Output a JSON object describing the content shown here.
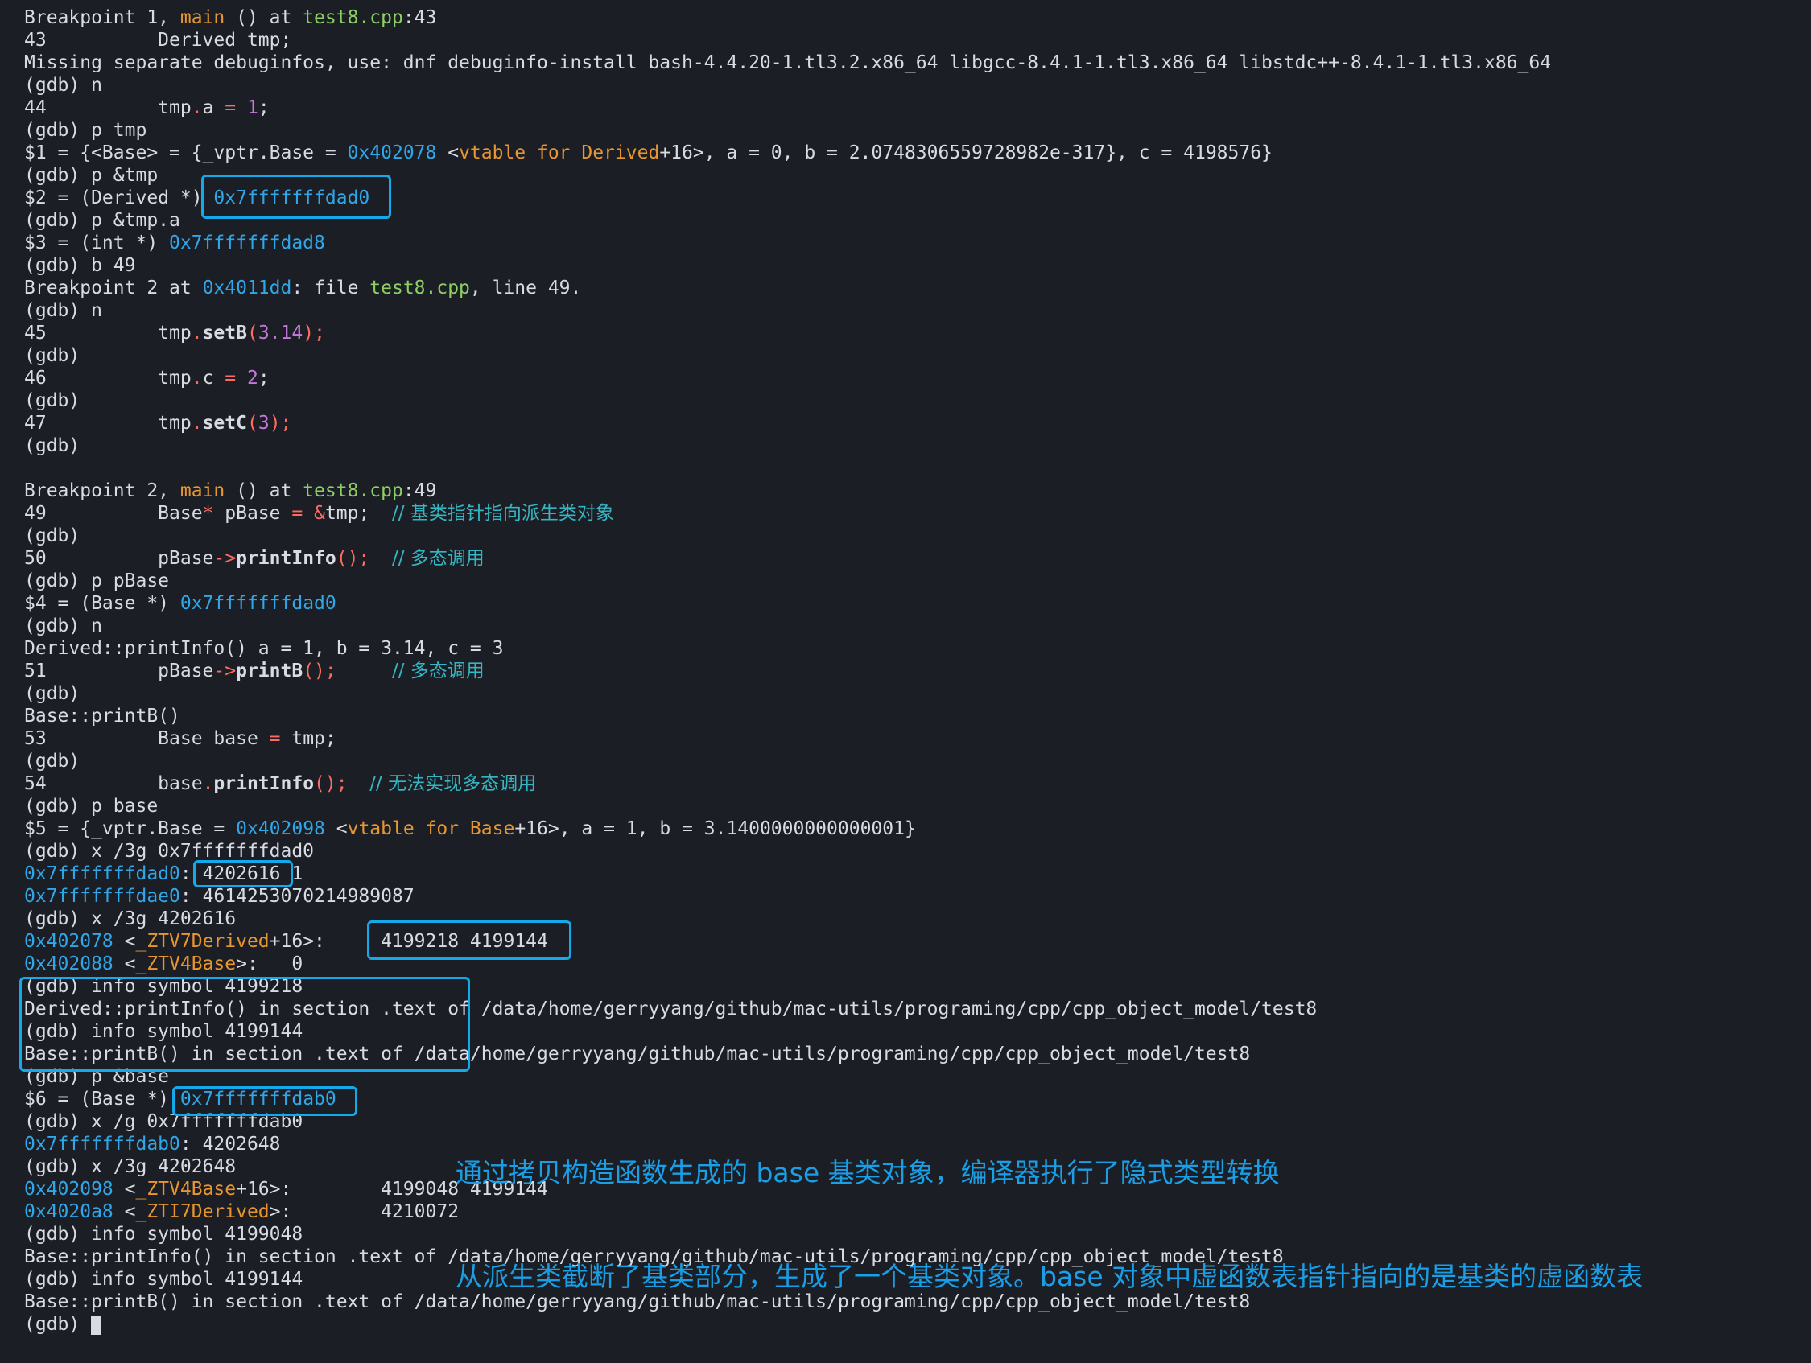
{
  "terminal": {
    "lines": [
      [
        [
          "Breakpoint 1, ",
          "def"
        ],
        [
          "main",
          "sym"
        ],
        [
          " () at ",
          "def"
        ],
        [
          "test8.cpp",
          "file"
        ],
        [
          ":43",
          "def"
        ]
      ],
      [
        [
          "43          Derived tmp;",
          "def"
        ]
      ],
      [
        [
          "Missing separate debuginfos, use: dnf debuginfo-install bash-4.4.20-1.tl3.2.x86_64 libgcc-8.4.1-1.tl3.x86_64 libstdc++-8.4.1-1.tl3.x86_64",
          "def"
        ]
      ],
      [
        [
          "(gdb) n",
          "def"
        ]
      ],
      [
        [
          "44          tmp",
          "def"
        ],
        [
          ".",
          "op"
        ],
        [
          "a ",
          "def"
        ],
        [
          "=",
          "op"
        ],
        [
          " ",
          "def"
        ],
        [
          "1",
          "num"
        ],
        [
          ";",
          "def"
        ]
      ],
      [
        [
          "(gdb) p tmp",
          "def"
        ]
      ],
      [
        [
          "$1 = {<Base> = {_vptr.Base = ",
          "def"
        ],
        [
          "0x402078",
          "addr"
        ],
        [
          " <",
          "def"
        ],
        [
          "vtable for Derived",
          "sym"
        ],
        [
          "+16>, a = 0, b = 2.0748306559728982e-317}, c = 4198576}",
          "def"
        ]
      ],
      [
        [
          "(gdb) p &tmp",
          "def"
        ]
      ],
      [
        [
          "$2 = (Derived *) ",
          "def"
        ],
        [
          "0x7fffffffdad0",
          "addr"
        ]
      ],
      [
        [
          "(gdb) p &tmp.a",
          "def"
        ]
      ],
      [
        [
          "$3 = (int *) ",
          "def"
        ],
        [
          "0x7fffffffdad8",
          "addr"
        ]
      ],
      [
        [
          "(gdb) b 49",
          "def"
        ]
      ],
      [
        [
          "Breakpoint 2 at ",
          "def"
        ],
        [
          "0x4011dd",
          "addr"
        ],
        [
          ": file ",
          "def"
        ],
        [
          "test8.cpp",
          "file"
        ],
        [
          ", line 49.",
          "def"
        ]
      ],
      [
        [
          "(gdb) n",
          "def"
        ]
      ],
      [
        [
          "45          tmp",
          "def"
        ],
        [
          ".",
          "op"
        ],
        [
          "setB",
          "fn"
        ],
        [
          "(",
          "op"
        ],
        [
          "3.14",
          "num"
        ],
        [
          ");",
          "op"
        ]
      ],
      [
        [
          "(gdb)",
          "def"
        ]
      ],
      [
        [
          "46          tmp",
          "def"
        ],
        [
          ".",
          "op"
        ],
        [
          "c ",
          "def"
        ],
        [
          "=",
          "op"
        ],
        [
          " ",
          "def"
        ],
        [
          "2",
          "num"
        ],
        [
          ";",
          "def"
        ]
      ],
      [
        [
          "(gdb)",
          "def"
        ]
      ],
      [
        [
          "47          tmp",
          "def"
        ],
        [
          ".",
          "op"
        ],
        [
          "setC",
          "fn"
        ],
        [
          "(",
          "op"
        ],
        [
          "3",
          "num"
        ],
        [
          ");",
          "op"
        ]
      ],
      [
        [
          "(gdb)",
          "def"
        ]
      ],
      [
        [
          "",
          "def"
        ]
      ],
      [
        [
          "Breakpoint 2, ",
          "def"
        ],
        [
          "main",
          "sym"
        ],
        [
          " () at ",
          "def"
        ],
        [
          "test8.cpp",
          "file"
        ],
        [
          ":49",
          "def"
        ]
      ],
      [
        [
          "49          Base",
          "def"
        ],
        [
          "*",
          "op"
        ],
        [
          " pBase ",
          "def"
        ],
        [
          "=",
          "op"
        ],
        [
          " ",
          "def"
        ],
        [
          "&",
          "op"
        ],
        [
          "tmp;  ",
          "def"
        ],
        [
          "// 基类指针指向派生类对象",
          "cjk"
        ]
      ],
      [
        [
          "(gdb)",
          "def"
        ]
      ],
      [
        [
          "50          pBase",
          "def"
        ],
        [
          "->",
          "op"
        ],
        [
          "printInfo",
          "fn"
        ],
        [
          "();",
          "op"
        ],
        [
          "  ",
          "def"
        ],
        [
          "// 多态调用",
          "cjk"
        ]
      ],
      [
        [
          "(gdb) p pBase",
          "def"
        ]
      ],
      [
        [
          "$4 = (Base *) ",
          "def"
        ],
        [
          "0x7fffffffdad0",
          "addr"
        ]
      ],
      [
        [
          "(gdb) n",
          "def"
        ]
      ],
      [
        [
          "Derived::printInfo() a = 1, b = 3.14, c = 3",
          "def"
        ]
      ],
      [
        [
          "51          pBase",
          "def"
        ],
        [
          "->",
          "op"
        ],
        [
          "printB",
          "fn"
        ],
        [
          "();",
          "op"
        ],
        [
          "     ",
          "def"
        ],
        [
          "// 多态调用",
          "cjk"
        ]
      ],
      [
        [
          "(gdb)",
          "def"
        ]
      ],
      [
        [
          "Base::printB()",
          "def"
        ]
      ],
      [
        [
          "53          Base base ",
          "def"
        ],
        [
          "=",
          "op"
        ],
        [
          " tmp;",
          "def"
        ]
      ],
      [
        [
          "(gdb)",
          "def"
        ]
      ],
      [
        [
          "54          base",
          "def"
        ],
        [
          ".",
          "op"
        ],
        [
          "printInfo",
          "fn"
        ],
        [
          "();",
          "op"
        ],
        [
          "  ",
          "def"
        ],
        [
          "// 无法实现多态调用",
          "cjk"
        ]
      ],
      [
        [
          "(gdb) p base",
          "def"
        ]
      ],
      [
        [
          "$5 = {_vptr.Base = ",
          "def"
        ],
        [
          "0x402098",
          "addr"
        ],
        [
          " <",
          "def"
        ],
        [
          "vtable for Base",
          "sym"
        ],
        [
          "+16>, a = 1, b = 3.1400000000000001}",
          "def"
        ]
      ],
      [
        [
          "(gdb) x /3g 0x7fffffffdad0",
          "def"
        ]
      ],
      [
        [
          "0x7fffffffdad0",
          "addr"
        ],
        [
          ": 4202616 1",
          "def"
        ]
      ],
      [
        [
          "0x7fffffffdae0",
          "addr"
        ],
        [
          ": 4614253070214989087",
          "def"
        ]
      ],
      [
        [
          "(gdb) x /3g 4202616",
          "def"
        ]
      ],
      [
        [
          "0x402078",
          "addr"
        ],
        [
          " <",
          "def"
        ],
        [
          "_ZTV7Derived",
          "sym"
        ],
        [
          "+16>:     4199218 4199144",
          "def"
        ]
      ],
      [
        [
          "0x402088",
          "addr"
        ],
        [
          " <",
          "def"
        ],
        [
          "_ZTV4Base",
          "sym"
        ],
        [
          ">:   0",
          "def"
        ]
      ],
      [
        [
          "(gdb) info symbol 4199218",
          "def"
        ]
      ],
      [
        [
          "Derived::printInfo() in section .text of /data/home/gerryyang/github/mac-utils/programing/cpp/cpp_object_model/test8",
          "def"
        ]
      ],
      [
        [
          "(gdb) info symbol 4199144",
          "def"
        ]
      ],
      [
        [
          "Base::printB() in section .text of /data/home/gerryyang/github/mac-utils/programing/cpp/cpp_object_model/test8",
          "def"
        ]
      ],
      [
        [
          "(gdb) p &base",
          "def"
        ]
      ],
      [
        [
          "$6 = (Base *) ",
          "def"
        ],
        [
          "0x7fffffffdab0",
          "addr"
        ]
      ],
      [
        [
          "(gdb) x /g 0x7fffffffdab0",
          "def"
        ]
      ],
      [
        [
          "0x7fffffffdab0",
          "addr"
        ],
        [
          ": 4202648",
          "def"
        ]
      ],
      [
        [
          "(gdb) x /3g 4202648",
          "def"
        ]
      ],
      [
        [
          "0x402098",
          "addr"
        ],
        [
          " <",
          "def"
        ],
        [
          "_ZTV4Base",
          "sym"
        ],
        [
          "+16>:        4199048 4199144",
          "def"
        ]
      ],
      [
        [
          "0x4020a8",
          "addr"
        ],
        [
          " <",
          "def"
        ],
        [
          "_ZTI7Derived",
          "sym"
        ],
        [
          ">:        4210072",
          "def"
        ]
      ],
      [
        [
          "(gdb) info symbol 4199048",
          "def"
        ]
      ],
      [
        [
          "Base::printInfo() in section .text of /data/home/gerryyang/github/mac-utils/programing/cpp/cpp_object_model/test8",
          "def"
        ]
      ],
      [
        [
          "(gdb) info symbol 4199144",
          "def"
        ]
      ],
      [
        [
          "Base::printB() in section .text of /data/home/gerryyang/github/mac-utils/programing/cpp/cpp_object_model/test8",
          "def"
        ]
      ],
      [
        [
          "(gdb) ",
          "def"
        ]
      ]
    ]
  },
  "annotation": {
    "line1": "通过拷贝构造函数生成的 base 基类对象，编译器执行了隐式类型转换",
    "line2": "从派生类截断了基类部分，生成了一个基类对象。base 对象中虚函数表指针指向的是基类的虚函数表"
  },
  "colors": {
    "background": "#1c1e25",
    "text": "#d8dbe2",
    "address": "#2fa7e8",
    "symbol": "#e8962f",
    "file": "#8dcf63",
    "number": "#c678dd",
    "operator": "#ff6b5f",
    "comment": "#35b6c2",
    "highlight_box": "#14a9ea",
    "annotation": "#1a9ee6"
  }
}
